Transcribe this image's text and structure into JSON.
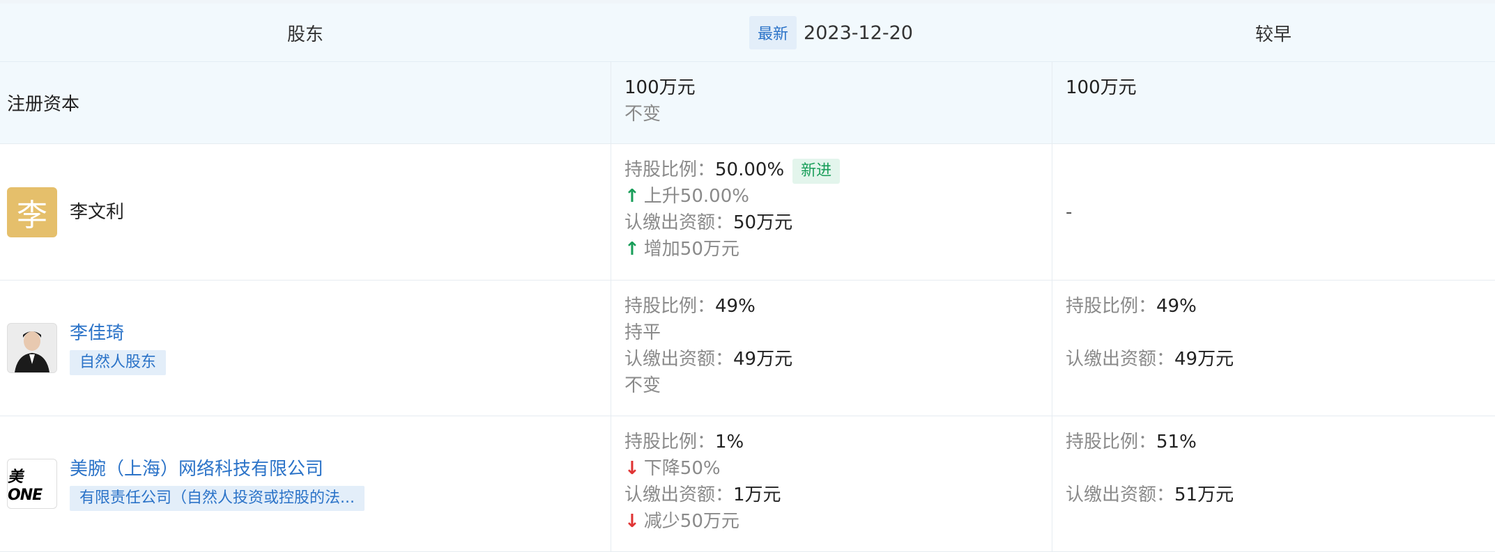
{
  "header": {
    "col_shareholder": "股东",
    "latest_badge": "最新",
    "latest_date": "2023-12-20",
    "col_earlier": "较早"
  },
  "registered_capital": {
    "label": "注册资本",
    "latest_value": "100万元",
    "latest_change": "不变",
    "earlier_value": "100万元"
  },
  "rows": [
    {
      "avatar_char": "李",
      "name": "李文利",
      "latest": {
        "ratio_label": "持股比例：",
        "ratio_value": "50.00%",
        "new_badge": "新进",
        "ratio_change": "上升50.00%",
        "amount_label": "认缴出资额：",
        "amount_value": "50万元",
        "amount_change": "增加50万元"
      },
      "earlier": {
        "empty": "-"
      }
    },
    {
      "name": "李佳琦",
      "tag": "自然人股东",
      "latest": {
        "ratio_label": "持股比例：",
        "ratio_value": "49%",
        "ratio_change": "持平",
        "amount_label": "认缴出资额：",
        "amount_value": "49万元",
        "amount_change": "不变"
      },
      "earlier": {
        "ratio_label": "持股比例：",
        "ratio_value": "49%",
        "amount_label": "认缴出资额：",
        "amount_value": "49万元"
      }
    },
    {
      "logo_text": "美ONE",
      "name": "美腕（上海）网络科技有限公司",
      "tag": "有限责任公司（自然人投资或控股的法...",
      "latest": {
        "ratio_label": "持股比例：",
        "ratio_value": "1%",
        "ratio_change": "下降50%",
        "amount_label": "认缴出资额：",
        "amount_value": "1万元",
        "amount_change": "减少50万元"
      },
      "earlier": {
        "ratio_label": "持股比例：",
        "ratio_value": "51%",
        "amount_label": "认缴出资额：",
        "amount_value": "51万元"
      }
    }
  ],
  "colors": {
    "header_bg": "#f2f9fd",
    "link_blue": "#2b73c8",
    "up_green": "#1a9e5a",
    "down_red": "#e03434",
    "avatar_gold": "#e5bf6b"
  }
}
